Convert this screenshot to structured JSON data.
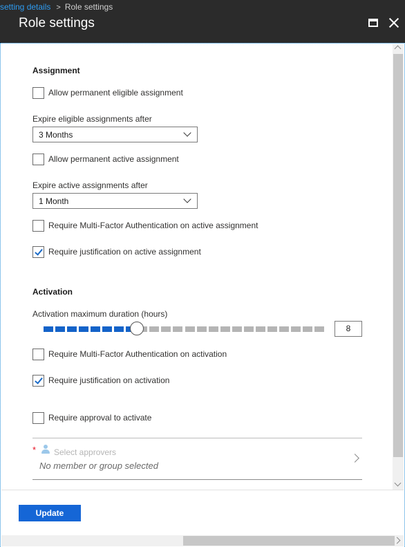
{
  "breadcrumb": {
    "parent": "setting details",
    "separator": ">",
    "current": "Role settings"
  },
  "blade": {
    "title": "Role settings"
  },
  "assignment": {
    "section_title": "Assignment",
    "allow_permanent_eligible": {
      "label": "Allow permanent eligible assignment",
      "checked": false
    },
    "expire_eligible": {
      "label": "Expire eligible assignments after",
      "value": "3 Months"
    },
    "allow_permanent_active": {
      "label": "Allow permanent active assignment",
      "checked": false
    },
    "expire_active": {
      "label": "Expire active assignments after",
      "value": "1 Month"
    },
    "require_mfa_active": {
      "label": "Require Multi-Factor Authentication on active assignment",
      "checked": false
    },
    "require_justification_active": {
      "label": "Require justification on active assignment",
      "checked": true
    }
  },
  "activation": {
    "section_title": "Activation",
    "max_duration": {
      "label": "Activation maximum duration (hours)",
      "value": "8",
      "max": 24
    },
    "require_mfa_activation": {
      "label": "Require Multi-Factor Authentication on activation",
      "checked": false
    },
    "require_justification_activation": {
      "label": "Require justification on activation",
      "checked": true
    },
    "require_approval": {
      "label": "Require approval to activate",
      "checked": false
    },
    "approvers": {
      "required_mark": "*",
      "placeholder": "Select approvers",
      "empty_text": "No member or group selected"
    }
  },
  "footer": {
    "update_label": "Update"
  },
  "colors": {
    "accent": "#1566d6",
    "slider_active": "#1463c9",
    "slider_inactive": "#b5b5b5",
    "titlebar": "#2b2b2b"
  },
  "icons": {
    "maximize": "maximize-icon",
    "close": "close-icon",
    "dropdown": "chevron-down-icon",
    "person": "person-icon",
    "navigate": "chevron-right-icon"
  }
}
